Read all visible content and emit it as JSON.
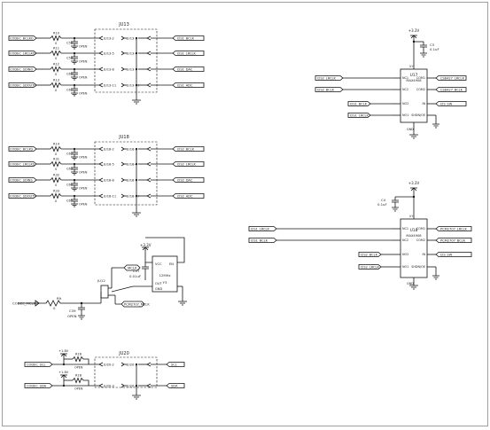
{
  "j013": {
    "ref": "JU13",
    "rows": [
      {
        "net_in": "CODEC_BCLKO",
        "res": "R10",
        "res_val": "0",
        "cap": "C58",
        "cap_val": "OPEN",
        "pin_a": "JU13-2",
        "pin_b": "JU13-1",
        "net_out": "I2S1_BCLK"
      },
      {
        "net_in": "CODEC_LRCLKO",
        "res": "R11",
        "res_val": "0",
        "cap": "C59",
        "cap_val": "OPEN",
        "pin_a": "JU13-5",
        "pin_b": "JU13-4",
        "net_out": "I2S1_LRCLK"
      },
      {
        "net_in": "CODEC_SDINO",
        "res": "R12",
        "res_val": "0",
        "cap": "C60",
        "cap_val": "OPEN",
        "pin_a": "JU13-8",
        "pin_b": "JU13-7",
        "net_out": "I2S1_DAC"
      },
      {
        "net_in": "CODEC_SDOUTO",
        "res": "R13",
        "res_val": "0",
        "cap": "C61",
        "cap_val": "OPEN",
        "pin_a": "JU13-11",
        "pin_b": "JU13-10",
        "net_out": "I2S1_ADC"
      }
    ]
  },
  "j018": {
    "ref": "JU18",
    "rows": [
      {
        "net_in": "CODEC_BCLKS",
        "res": "R14",
        "res_val": "0",
        "cap": "C62",
        "cap_val": "OPEN",
        "pin_a": "JU18-2",
        "pin_b": "JU18-1",
        "net_out": "I2S2_BCLK"
      },
      {
        "net_in": "CODEC_LRCLKS",
        "res": "R31",
        "res_val": "0",
        "cap": "C63",
        "cap_val": "OPEN",
        "pin_a": "JU18-5",
        "pin_b": "JU18-4",
        "net_out": "I2S2_LRCLK"
      },
      {
        "net_in": "CODEC_SDINS",
        "res": "R32",
        "res_val": "0",
        "cap": "C64",
        "cap_val": "OPEN",
        "pin_a": "JU18-8",
        "pin_b": "JU18-7",
        "net_out": "I2S2_DAC"
      },
      {
        "net_in": "CODEC_SDOUTS",
        "res": "R33",
        "res_val": "0",
        "cap": "C65",
        "cap_val": "OPEN",
        "pin_a": "JU18-11",
        "pin_b": "JU18-10",
        "net_out": "I2S2_ADC"
      }
    ]
  },
  "osc": {
    "supply": "+3.3V",
    "net_in": "CODEC_MCLK",
    "res": "R9",
    "res_val": "0",
    "cap": "C39",
    "cap_val": "OPEN",
    "jumper": "JU12",
    "jp_pins": [
      "1",
      "2",
      "3"
    ],
    "net_mclk": "MCLK",
    "net_pcm": "PCM2707_MCLK",
    "bypass_cap": "C57",
    "bypass_val": "0.01uF",
    "xtal": "Y3",
    "freq": "12MHz",
    "pin_vcc": "VCC",
    "pin_en": "EN",
    "pin_gnd": "GND",
    "pin_out": "OUT",
    "pin_nums": [
      "4",
      "1",
      "2",
      "3"
    ]
  },
  "j020": {
    "ref": "JU20",
    "rows": [
      {
        "net_in": "CODEC_SCL",
        "pull": "+1.8V",
        "res": "R16",
        "res_val": "OPEN",
        "pin_a": "JU20-2",
        "pin_b": "JU20-1",
        "net_out": "SCL"
      },
      {
        "net_in": "CODEC_SDA",
        "pull": "+1.8V",
        "res": "R18",
        "res_val": "OPEN",
        "pin_a": "JU20-3",
        "pin_b": "JU20-4",
        "net_out": "SDA"
      }
    ]
  },
  "u17": {
    "ref": "U17",
    "part": "MAX4908",
    "supply": "+3.3V",
    "cap": "C3",
    "cap_val": "0.1uF",
    "left_pins": [
      "NC1",
      "NC2",
      "NO2",
      "NO1"
    ],
    "right_pins": [
      "COM1",
      "COM2",
      "IN",
      "SHDN/OE"
    ],
    "top_pin": "V+",
    "bot_pin": "GND",
    "nets_left": [
      "I2S2_LRCLK",
      "I2S2_BCLK",
      "I2S1_BCLK",
      "I2S1_LRCLK"
    ],
    "nets_right": [
      "CS8427_LRCLK",
      "CS8427_BCLK",
      "I2S_SW"
    ]
  },
  "u18": {
    "ref": "U18",
    "part": "MAX4908",
    "supply": "+3.3V",
    "cap": "C4",
    "cap_val": "0.1uF",
    "left_pins": [
      "NC1",
      "NC2",
      "NO2",
      "NO1"
    ],
    "right_pins": [
      "COM1",
      "COM2",
      "IN",
      "SHDN/OE"
    ],
    "top_pin": "V+",
    "bot_pin": "GND",
    "nets_left": [
      "I2S1_LRCLK",
      "I2S1_BCLK",
      "I2S2_BCLK",
      "I2S2_LRCLK"
    ],
    "nets_right": [
      "PCM2707_LRCLK",
      "PCM2707_BCLK",
      "I2S_SW"
    ]
  }
}
